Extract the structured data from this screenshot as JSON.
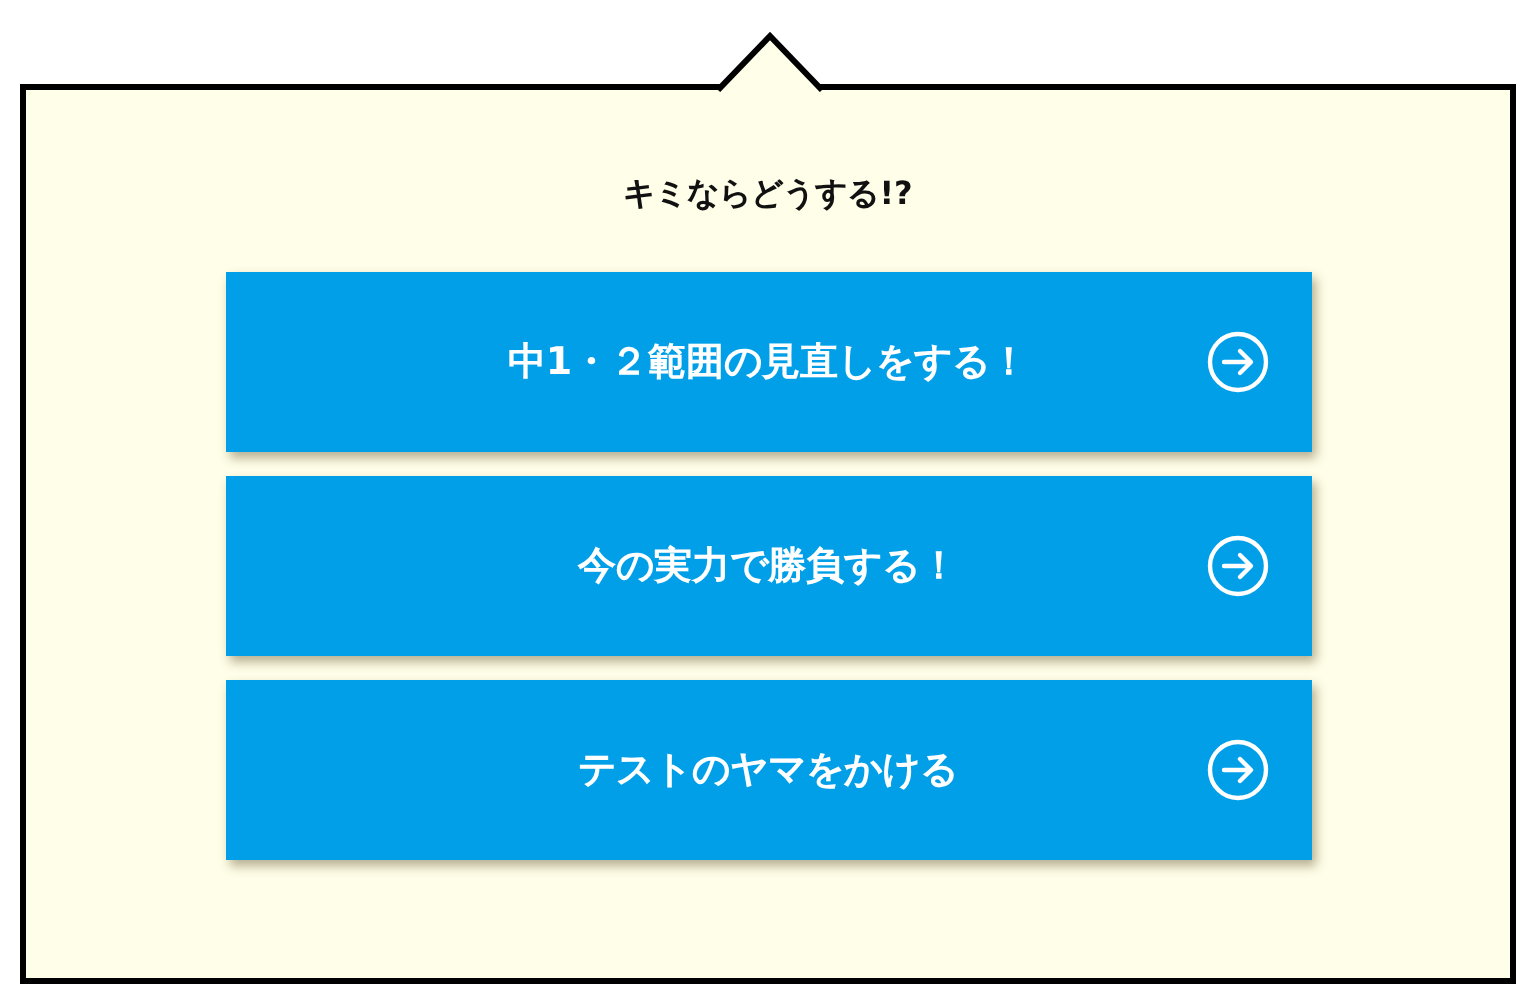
{
  "prompt": "キミならどうする!?",
  "choices": [
    {
      "label": "中1・２範囲の見直しをする！"
    },
    {
      "label": "今の実力で勝負する！"
    },
    {
      "label": "テストのヤマをかける"
    }
  ]
}
